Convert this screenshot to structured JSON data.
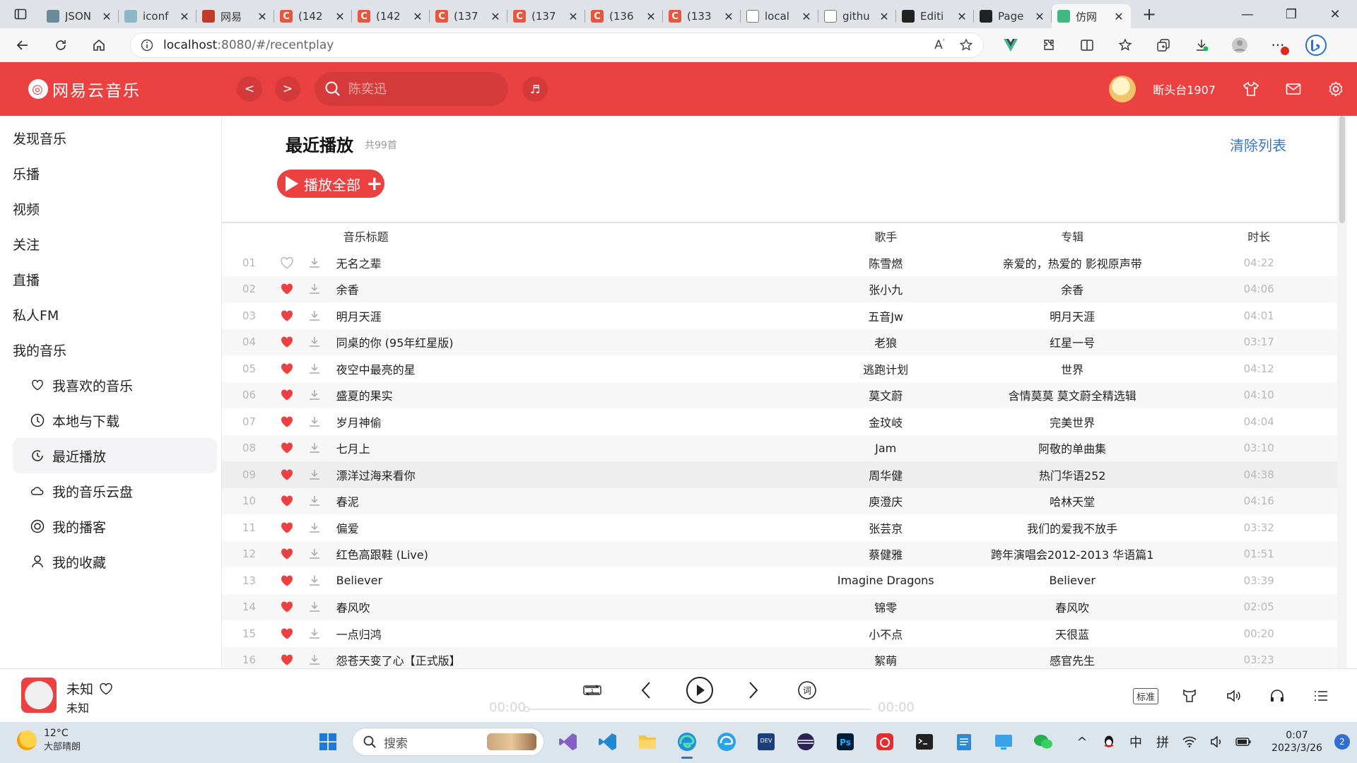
{
  "browser": {
    "tabs": [
      {
        "title": "JSON",
        "fav_color": "#6a8a9a",
        "fav_text": ""
      },
      {
        "title": "iconf",
        "fav_color": "#8bb8c8",
        "fav_text": ""
      },
      {
        "title": "网易",
        "fav_color": "#c0392b",
        "fav_text": ""
      },
      {
        "title": "(142",
        "fav_color": "#e8563f",
        "fav_text": "C"
      },
      {
        "title": "(142",
        "fav_color": "#e8563f",
        "fav_text": "C"
      },
      {
        "title": "(137",
        "fav_color": "#e8563f",
        "fav_text": "C"
      },
      {
        "title": "(137",
        "fav_color": "#e8563f",
        "fav_text": "C"
      },
      {
        "title": "(136",
        "fav_color": "#e8563f",
        "fav_text": "C"
      },
      {
        "title": "(133",
        "fav_color": "#e8563f",
        "fav_text": "C"
      },
      {
        "title": "local",
        "fav_color": "#ffffff",
        "fav_text": ""
      },
      {
        "title": "githu",
        "fav_color": "#ffffff",
        "fav_text": ""
      },
      {
        "title": "Editi",
        "fav_color": "#222222",
        "fav_text": ""
      },
      {
        "title": "Page",
        "fav_color": "#222222",
        "fav_text": ""
      },
      {
        "title": "仿网",
        "fav_color": "#41b883",
        "fav_text": ""
      }
    ],
    "url_host": "localhost",
    "url_path": ":8080/#/recentplay"
  },
  "app": {
    "logo_text": "网易云音乐",
    "back_label": "<",
    "forward_label": ">",
    "search_placeholder": "陈奕迅",
    "username": "断头台1907",
    "accent": "#ec4141"
  },
  "sidebar": {
    "items": [
      "发现音乐",
      "乐播",
      "视频",
      "关注",
      "直播",
      "私人FM",
      "我的音乐"
    ],
    "sub_items": [
      {
        "label": "我喜欢的音乐",
        "icon": "heart-outline-icon"
      },
      {
        "label": "本地与下载",
        "icon": "download-circle-icon"
      },
      {
        "label": "最近播放",
        "icon": "recent-icon"
      },
      {
        "label": "我的音乐云盘",
        "icon": "cloud-icon"
      },
      {
        "label": "我的播客",
        "icon": "podcast-icon"
      },
      {
        "label": "我的收藏",
        "icon": "user-icon"
      }
    ]
  },
  "page": {
    "title": "最近播放",
    "count": "共99首",
    "clear_label": "清除列表",
    "play_all_label": "播放全部",
    "headers": {
      "title": "音乐标题",
      "artist": "歌手",
      "album": "专辑",
      "duration": "时长"
    }
  },
  "songs": [
    {
      "idx": "01",
      "liked": false,
      "title": "无名之辈",
      "artist": "陈雪燃",
      "album": "亲爱的，热爱的 影视原声带",
      "time": "04:22"
    },
    {
      "idx": "02",
      "liked": true,
      "title": "余香",
      "artist": "张小九",
      "album": "余香",
      "time": "04:06"
    },
    {
      "idx": "03",
      "liked": true,
      "title": "明月天涯",
      "artist": "五音Jw",
      "album": "明月天涯",
      "time": "04:01"
    },
    {
      "idx": "04",
      "liked": true,
      "title": "同桌的你 (95年红星版)",
      "artist": "老狼",
      "album": "红星一号",
      "time": "03:17"
    },
    {
      "idx": "05",
      "liked": true,
      "title": "夜空中最亮的星",
      "artist": "逃跑计划",
      "album": "世界",
      "time": "04:12"
    },
    {
      "idx": "06",
      "liked": true,
      "title": "盛夏的果实",
      "artist": "莫文蔚",
      "album": "含情莫莫 莫文蔚全精选辑",
      "time": "04:10"
    },
    {
      "idx": "07",
      "liked": true,
      "title": "岁月神偷",
      "artist": "金玟岐",
      "album": "完美世界",
      "time": "04:04"
    },
    {
      "idx": "08",
      "liked": true,
      "title": "七月上",
      "artist": "Jam",
      "album": "阿敬的单曲集",
      "time": "03:10"
    },
    {
      "idx": "09",
      "liked": true,
      "title": "漂洋过海来看你",
      "artist": "周华健",
      "album": "热门华语252",
      "time": "04:38"
    },
    {
      "idx": "10",
      "liked": true,
      "title": "春泥",
      "artist": "庾澄庆",
      "album": "哈林天堂",
      "time": "04:16"
    },
    {
      "idx": "11",
      "liked": true,
      "title": "偏爱",
      "artist": "张芸京",
      "album": "我们的爱我不放手",
      "time": "03:32"
    },
    {
      "idx": "12",
      "liked": true,
      "title": "红色高跟鞋 (Live)",
      "artist": "蔡健雅",
      "album": "跨年演唱会2012-2013 华语篇1",
      "time": "01:51"
    },
    {
      "idx": "13",
      "liked": true,
      "title": "Believer",
      "artist": "Imagine Dragons",
      "album": "Believer",
      "time": "03:39"
    },
    {
      "idx": "14",
      "liked": true,
      "title": "春风吹",
      "artist": "锦零",
      "album": "春风吹",
      "time": "02:05"
    },
    {
      "idx": "15",
      "liked": true,
      "title": "一点归鸿",
      "artist": "小不点",
      "album": "天很蓝",
      "time": "00:20"
    },
    {
      "idx": "16",
      "liked": true,
      "title": "怨苍天变了心【正式版】",
      "artist": "絮萌",
      "album": "感官先生",
      "time": "03:23"
    }
  ],
  "player": {
    "track": "未知",
    "artist": "未知",
    "current": "00:00",
    "total": "00:00",
    "quality": "标准"
  },
  "taskbar": {
    "temp": "12°C",
    "weather": "大部晴朗",
    "search_placeholder": "搜索",
    "ime1": "中",
    "ime2": "拼",
    "time": "0:07",
    "date": "2023/3/26",
    "notifications": "2"
  }
}
